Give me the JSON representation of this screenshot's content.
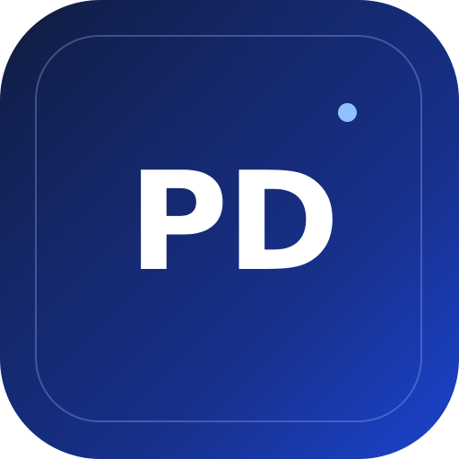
{
  "icon": {
    "monogram": "PD",
    "dot_color": "#8fc1ff",
    "text_color": "#ffffff",
    "gradient_start": "#101c3f",
    "gradient_end": "#1b44cf"
  }
}
